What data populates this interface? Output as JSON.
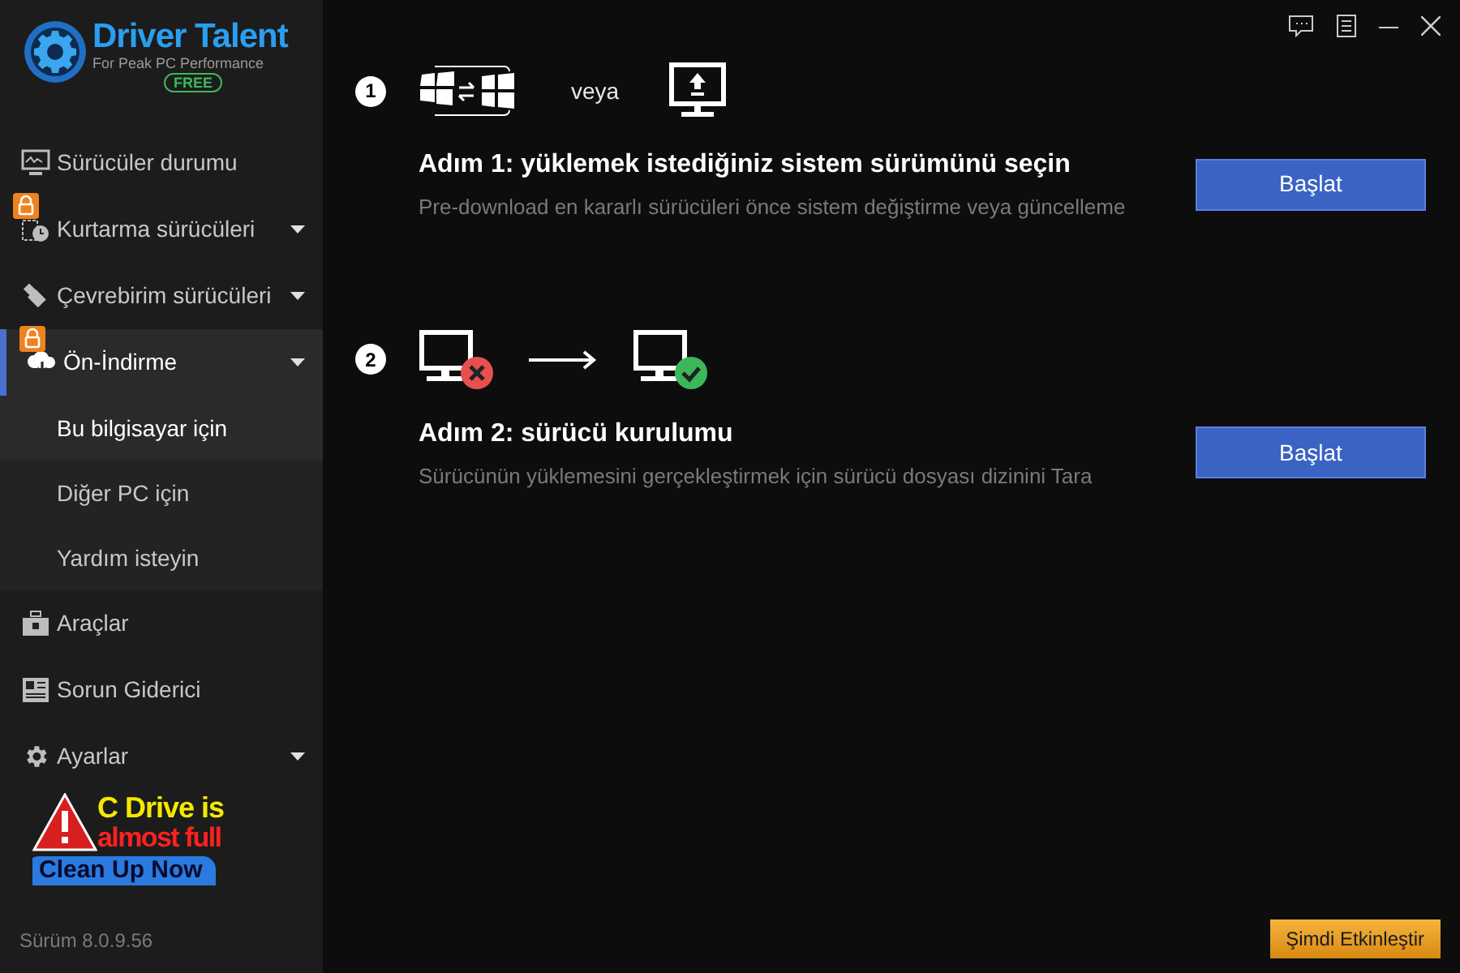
{
  "logo": {
    "name": "Driver Talent",
    "tagline": "For Peak PC Performance",
    "edition": "FREE"
  },
  "sidebar": {
    "items": [
      {
        "label": "Sürücüler durumu",
        "kind": "monitor",
        "locked": false,
        "expandable": false,
        "selected": false
      },
      {
        "label": "Kurtarma sürücüleri",
        "kind": "restore",
        "locked": true,
        "expandable": true,
        "selected": false
      },
      {
        "label": "Çevrebirim sürücüleri",
        "kind": "usb",
        "locked": false,
        "expandable": true,
        "selected": false
      },
      {
        "label": "Ön-İndirme",
        "kind": "download",
        "locked": true,
        "expandable": true,
        "selected": true,
        "expanded": true,
        "children": [
          {
            "label": "Bu bilgisayar için",
            "selected": true
          },
          {
            "label": "Diğer PC için",
            "selected": false
          },
          {
            "label": "Yardım isteyin",
            "selected": false
          }
        ]
      },
      {
        "label": "Araçlar",
        "kind": "toolbox",
        "locked": false,
        "expandable": false,
        "selected": false
      },
      {
        "label": "Sorun Giderici",
        "kind": "panel",
        "locked": false,
        "expandable": false,
        "selected": false
      },
      {
        "label": "Ayarlar",
        "kind": "gear",
        "locked": false,
        "expandable": true,
        "selected": false
      }
    ]
  },
  "ad": {
    "line_1": "C Drive is",
    "line_2": "almost full",
    "button": "Clean Up Now"
  },
  "version": "Sürüm 8.0.9.56",
  "steps": [
    {
      "number": "1",
      "kind": "choose",
      "or_text": "veya",
      "title": "Adım 1: yüklemek istediğiniz sistem sürümünü seçin",
      "description": "Pre-download en kararlı sürücüleri önce sistem değiştirme veya güncelleme",
      "button": "Başlat"
    },
    {
      "number": "2",
      "kind": "install",
      "title": "Adım 2: sürücü kurulumu",
      "description": "Sürücünün yüklemesini gerçekleştirmek için sürücü dosyası dizinini Tara",
      "button": "Başlat"
    }
  ],
  "activate_button": "Şimdi Etkinleştir"
}
